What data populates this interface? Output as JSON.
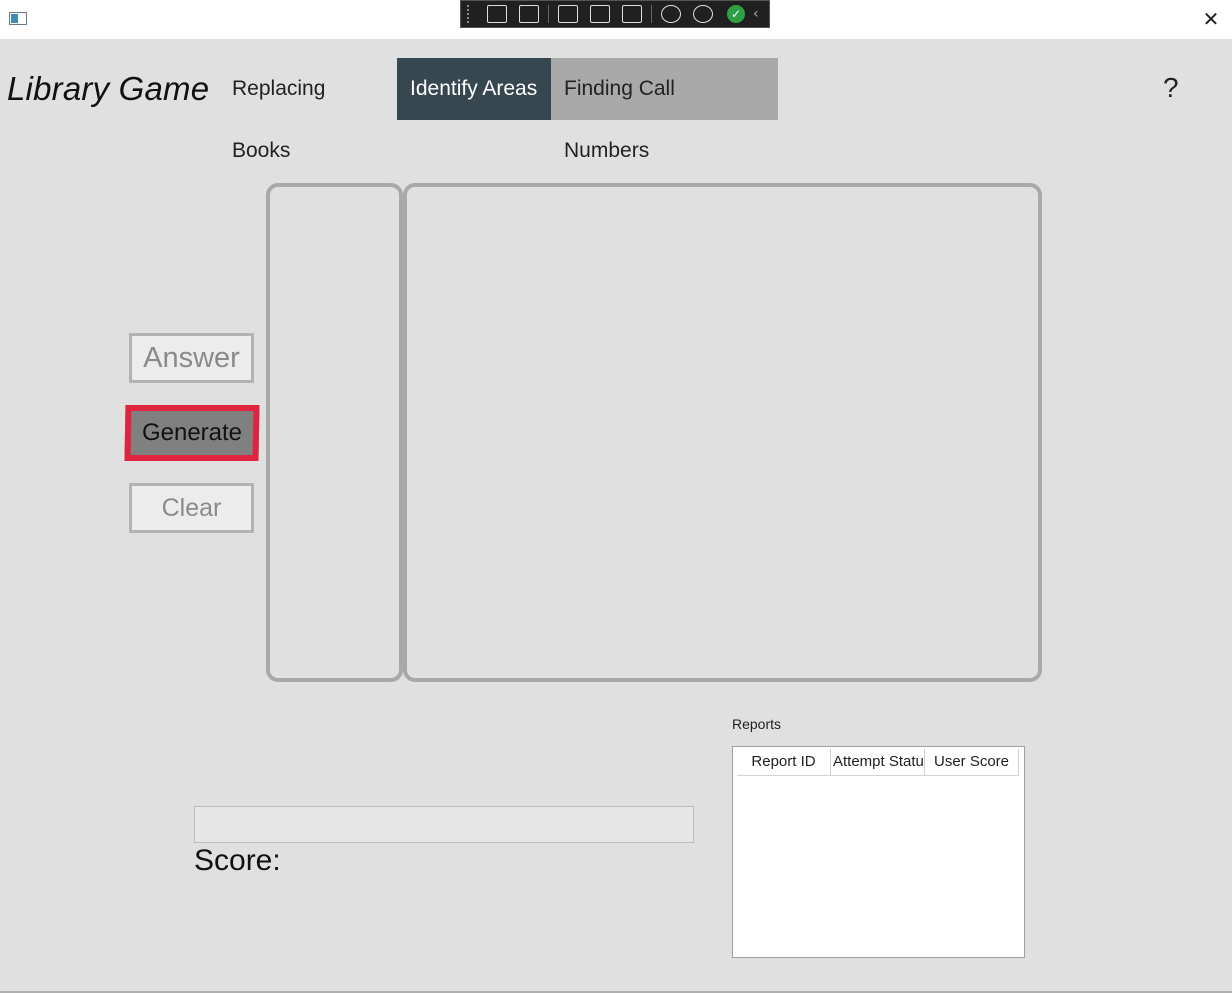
{
  "window": {
    "close_glyph": "✕",
    "app_icon": "app-window-icon"
  },
  "devtools": {
    "icons": [
      "live-visual-tree-icon",
      "camera-icon",
      "select-element-icon",
      "display-layout-adorners-icon",
      "track-focus-icon",
      "binding-failures-icon",
      "accessibility-icon",
      "checkmark-icon"
    ],
    "check_glyph": "✓",
    "collapse_glyph": "‹"
  },
  "header": {
    "app_title": "Library Game",
    "tabs": [
      {
        "label": "Replacing Books",
        "state": "normal"
      },
      {
        "label": "Identify Areas",
        "state": "selected"
      },
      {
        "label": "Finding Call Numbers",
        "state": "inactive"
      }
    ],
    "help_label": "?"
  },
  "controls": {
    "answer_label": "Answer",
    "generate_label": "Generate",
    "clear_label": "Clear"
  },
  "score": {
    "label": "Score:",
    "progress": 0
  },
  "reports": {
    "label": "Reports",
    "columns": [
      "Report ID",
      "Attempt Status",
      "User Score"
    ],
    "rows": []
  },
  "colors": {
    "selected_tab": "#37474f",
    "inactive_tab": "#a9a9a9",
    "focus_border": "#e0243f",
    "background": "#e0e0e0"
  }
}
